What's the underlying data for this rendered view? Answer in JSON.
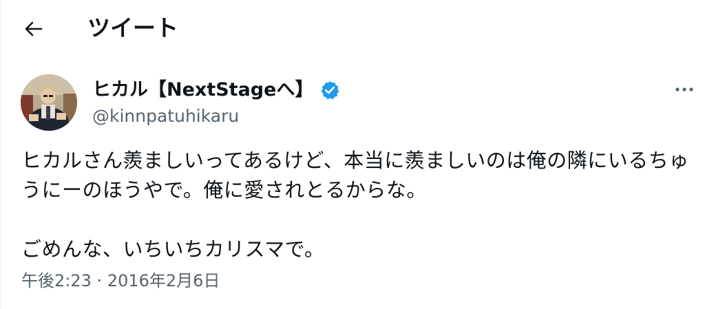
{
  "header": {
    "title": "ツイート",
    "back_icon": "arrow-left-icon"
  },
  "tweet": {
    "author": {
      "display_name": "ヒカル【NextStageへ】",
      "handle": "@kinnpatuhikaru",
      "verified": true,
      "verified_icon": "verified-badge-icon"
    },
    "more_icon": "more-options-icon",
    "text_para1": "ヒカルさん羨ましいってあるけど、本当に羨ましいのは俺の隣にいるちゅうにーのほうやで。俺に愛されとるからな。",
    "text_para2": "ごめんな、いちいちカリスマで。",
    "time": "午後2:23",
    "separator": "·",
    "date": "2016年2月6日"
  },
  "colors": {
    "text": "#0f1419",
    "secondary_text": "#536471",
    "verified_blue": "#1d9bf0",
    "background": "#ffffff"
  }
}
